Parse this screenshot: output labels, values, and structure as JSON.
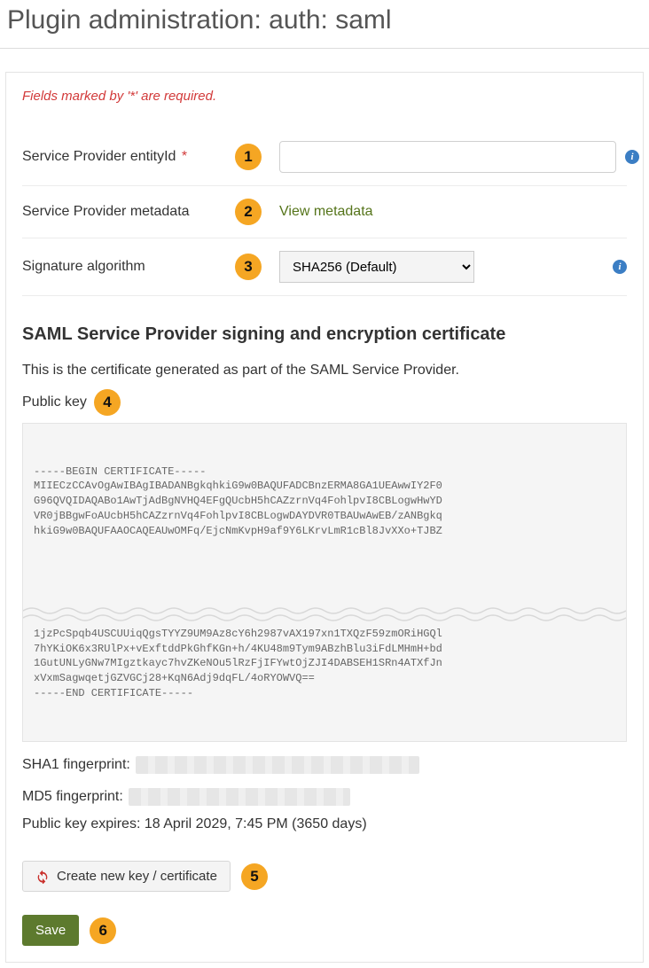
{
  "page_title": "Plugin administration: auth: saml",
  "required_note": "Fields marked by '*' are required.",
  "badges": {
    "b1": "1",
    "b2": "2",
    "b3": "3",
    "b4": "4",
    "b5": "5",
    "b6": "6"
  },
  "fields": {
    "entityId": {
      "label": "Service Provider entityId",
      "required": "*",
      "value": ""
    },
    "metadata": {
      "label": "Service Provider metadata",
      "link": "View metadata"
    },
    "sigalg": {
      "label": "Signature algorithm",
      "selected": "SHA256 (Default)"
    }
  },
  "cert_section": {
    "heading": "SAML Service Provider signing and encryption certificate",
    "description": "This is the certificate generated as part of the SAML Service Provider.",
    "pk_label": "Public key",
    "cert_top": "-----BEGIN CERTIFICATE-----\nMIIECzCCAvOgAwIBAgIBADANBgkqhkiG9w0BAQUFADCBnzERMA8GA1UEAwwIY2F0\nG96QVQIDAQABo1AwTjAdBgNVHQ4EFgQUcbH5hCAZzrnVq4FohlpvI8CBLogwHwYD\nVR0jBBgwFoAUcbH5hCAZzrnVq4FohlpvI8CBLogwDAYDVR0TBAUwAwEB/zANBgkq\nhkiG9w0BAQUFAAOCAQEAUwOMFq/EjcNmKvpH9af9Y6LKrvLmR1cBl8JvXXo+TJBZ",
    "cert_bot": "1jzPcSpqb4USCUUiqQgsTYYZ9UM9Az8cY6h2987vAX197xn1TXQzF59zmORiHGQl\n7hYKiOK6x3RUlPx+vExftddPkGhfKGn+h/4KU48m9Tym9ABzhBlu3iFdLMHmH+bd\n1GutUNLyGNw7MIgztkayc7hvZKeNOu5lRzFjIFYwtOjZJI4DABSEH1SRn4ATXfJn\nxVxmSagwqetjGZVGCj28+KqN6Adj9dqFL/4oRYOWVQ==\n-----END CERTIFICATE-----",
    "sha1_label": "SHA1 fingerprint:",
    "md5_label": "MD5 fingerprint:",
    "expiry_label": "Public key expires: 18 April 2029, 7:45 PM (3650 days)"
  },
  "buttons": {
    "create_cert": "Create new key / certificate",
    "save": "Save"
  },
  "info_glyph": "i"
}
